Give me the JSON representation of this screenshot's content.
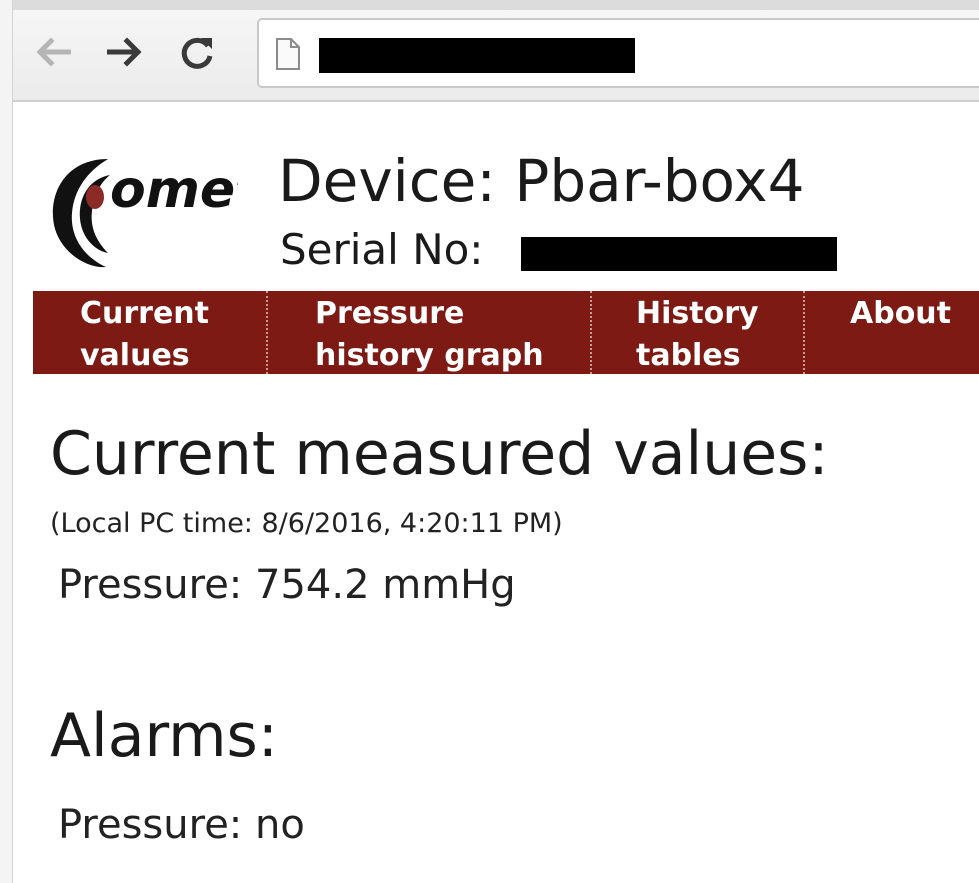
{
  "browser": {
    "back_icon": "arrow-left-icon",
    "forward_icon": "arrow-right-icon",
    "reload_icon": "reload-icon",
    "page_icon": "page-icon"
  },
  "header": {
    "logo_text": "omet",
    "device_label": "Device:",
    "device_name": "Pbar-box4",
    "serial_label": "Serial No:"
  },
  "nav": {
    "items": [
      {
        "line1": "Current",
        "line2": "values"
      },
      {
        "line1": "Pressure",
        "line2": "history graph"
      },
      {
        "line1": "History",
        "line2": "tables"
      },
      {
        "line1": "About",
        "line2": ""
      }
    ],
    "color": "#7d1a13"
  },
  "main": {
    "current_heading": "Current measured values:",
    "local_time": "(Local PC time: 8/6/2016, 4:20:11 PM)",
    "pressure_label": "Pressure:",
    "pressure_value": "754.2",
    "pressure_unit": "mmHg",
    "alarms_heading": "Alarms:",
    "alarm_pressure_label": "Pressure:",
    "alarm_pressure_value": "no"
  }
}
